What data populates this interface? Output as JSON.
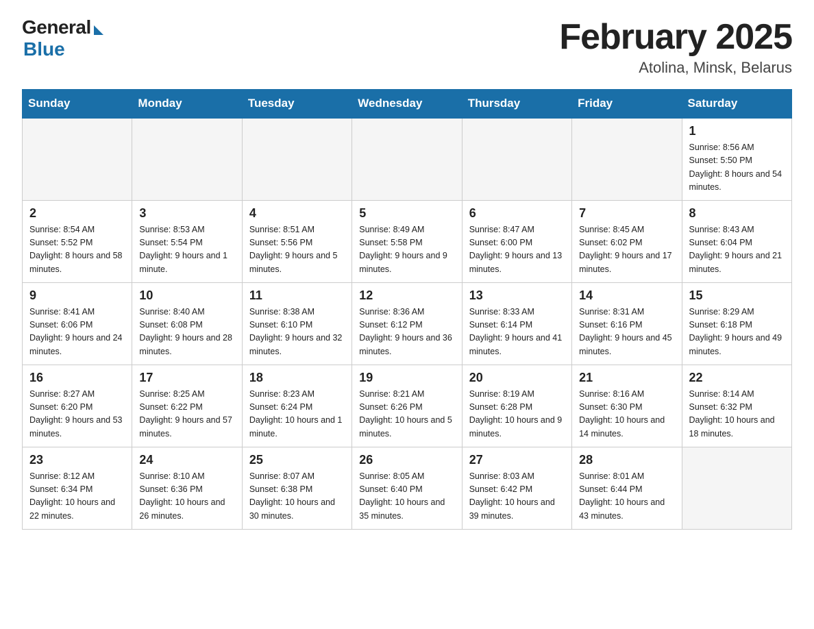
{
  "header": {
    "logo_general": "General",
    "logo_blue": "Blue",
    "month_title": "February 2025",
    "location": "Atolina, Minsk, Belarus"
  },
  "weekdays": [
    "Sunday",
    "Monday",
    "Tuesday",
    "Wednesday",
    "Thursday",
    "Friday",
    "Saturday"
  ],
  "weeks": [
    [
      {
        "day": "",
        "info": ""
      },
      {
        "day": "",
        "info": ""
      },
      {
        "day": "",
        "info": ""
      },
      {
        "day": "",
        "info": ""
      },
      {
        "day": "",
        "info": ""
      },
      {
        "day": "",
        "info": ""
      },
      {
        "day": "1",
        "info": "Sunrise: 8:56 AM\nSunset: 5:50 PM\nDaylight: 8 hours and 54 minutes."
      }
    ],
    [
      {
        "day": "2",
        "info": "Sunrise: 8:54 AM\nSunset: 5:52 PM\nDaylight: 8 hours and 58 minutes."
      },
      {
        "day": "3",
        "info": "Sunrise: 8:53 AM\nSunset: 5:54 PM\nDaylight: 9 hours and 1 minute."
      },
      {
        "day": "4",
        "info": "Sunrise: 8:51 AM\nSunset: 5:56 PM\nDaylight: 9 hours and 5 minutes."
      },
      {
        "day": "5",
        "info": "Sunrise: 8:49 AM\nSunset: 5:58 PM\nDaylight: 9 hours and 9 minutes."
      },
      {
        "day": "6",
        "info": "Sunrise: 8:47 AM\nSunset: 6:00 PM\nDaylight: 9 hours and 13 minutes."
      },
      {
        "day": "7",
        "info": "Sunrise: 8:45 AM\nSunset: 6:02 PM\nDaylight: 9 hours and 17 minutes."
      },
      {
        "day": "8",
        "info": "Sunrise: 8:43 AM\nSunset: 6:04 PM\nDaylight: 9 hours and 21 minutes."
      }
    ],
    [
      {
        "day": "9",
        "info": "Sunrise: 8:41 AM\nSunset: 6:06 PM\nDaylight: 9 hours and 24 minutes."
      },
      {
        "day": "10",
        "info": "Sunrise: 8:40 AM\nSunset: 6:08 PM\nDaylight: 9 hours and 28 minutes."
      },
      {
        "day": "11",
        "info": "Sunrise: 8:38 AM\nSunset: 6:10 PM\nDaylight: 9 hours and 32 minutes."
      },
      {
        "day": "12",
        "info": "Sunrise: 8:36 AM\nSunset: 6:12 PM\nDaylight: 9 hours and 36 minutes."
      },
      {
        "day": "13",
        "info": "Sunrise: 8:33 AM\nSunset: 6:14 PM\nDaylight: 9 hours and 41 minutes."
      },
      {
        "day": "14",
        "info": "Sunrise: 8:31 AM\nSunset: 6:16 PM\nDaylight: 9 hours and 45 minutes."
      },
      {
        "day": "15",
        "info": "Sunrise: 8:29 AM\nSunset: 6:18 PM\nDaylight: 9 hours and 49 minutes."
      }
    ],
    [
      {
        "day": "16",
        "info": "Sunrise: 8:27 AM\nSunset: 6:20 PM\nDaylight: 9 hours and 53 minutes."
      },
      {
        "day": "17",
        "info": "Sunrise: 8:25 AM\nSunset: 6:22 PM\nDaylight: 9 hours and 57 minutes."
      },
      {
        "day": "18",
        "info": "Sunrise: 8:23 AM\nSunset: 6:24 PM\nDaylight: 10 hours and 1 minute."
      },
      {
        "day": "19",
        "info": "Sunrise: 8:21 AM\nSunset: 6:26 PM\nDaylight: 10 hours and 5 minutes."
      },
      {
        "day": "20",
        "info": "Sunrise: 8:19 AM\nSunset: 6:28 PM\nDaylight: 10 hours and 9 minutes."
      },
      {
        "day": "21",
        "info": "Sunrise: 8:16 AM\nSunset: 6:30 PM\nDaylight: 10 hours and 14 minutes."
      },
      {
        "day": "22",
        "info": "Sunrise: 8:14 AM\nSunset: 6:32 PM\nDaylight: 10 hours and 18 minutes."
      }
    ],
    [
      {
        "day": "23",
        "info": "Sunrise: 8:12 AM\nSunset: 6:34 PM\nDaylight: 10 hours and 22 minutes."
      },
      {
        "day": "24",
        "info": "Sunrise: 8:10 AM\nSunset: 6:36 PM\nDaylight: 10 hours and 26 minutes."
      },
      {
        "day": "25",
        "info": "Sunrise: 8:07 AM\nSunset: 6:38 PM\nDaylight: 10 hours and 30 minutes."
      },
      {
        "day": "26",
        "info": "Sunrise: 8:05 AM\nSunset: 6:40 PM\nDaylight: 10 hours and 35 minutes."
      },
      {
        "day": "27",
        "info": "Sunrise: 8:03 AM\nSunset: 6:42 PM\nDaylight: 10 hours and 39 minutes."
      },
      {
        "day": "28",
        "info": "Sunrise: 8:01 AM\nSunset: 6:44 PM\nDaylight: 10 hours and 43 minutes."
      },
      {
        "day": "",
        "info": ""
      }
    ]
  ]
}
